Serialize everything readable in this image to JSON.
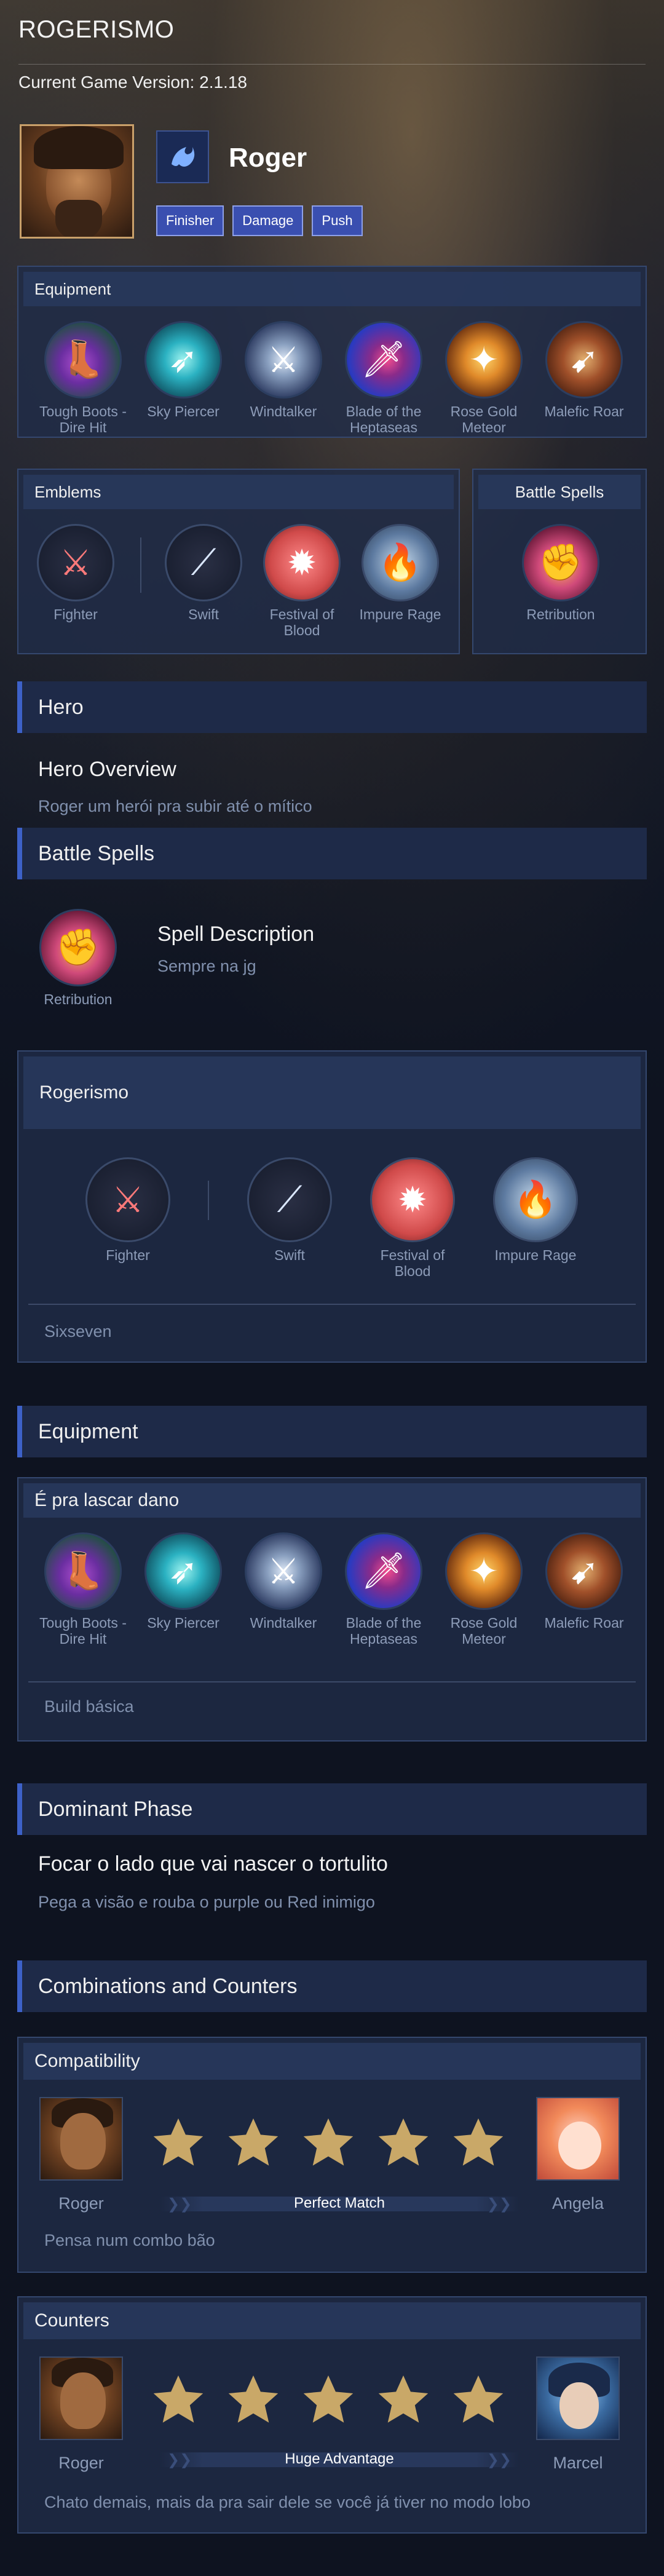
{
  "app_title": "ROGERISMO",
  "game_version": "Current Game Version: 2.1.18",
  "hero": {
    "name": "Roger",
    "tags": [
      "Finisher",
      "Damage",
      "Push"
    ]
  },
  "equipment_panel": {
    "title": "Equipment",
    "items": [
      {
        "label": "Tough Boots - Dire Hit",
        "icon": "boots-icon"
      },
      {
        "label": "Sky Piercer",
        "icon": "sky-piercer-icon"
      },
      {
        "label": "Windtalker",
        "icon": "windtalker-icon"
      },
      {
        "label": "Blade of the Heptaseas",
        "icon": "blade-icon"
      },
      {
        "label": "Rose Gold Meteor",
        "icon": "rose-gold-meteor-icon"
      },
      {
        "label": "Malefic Roar",
        "icon": "malefic-roar-icon"
      }
    ]
  },
  "emblems_panel": {
    "title": "Emblems",
    "main": "Fighter",
    "talents": [
      "Swift",
      "Festival of Blood",
      "Impure Rage"
    ]
  },
  "battle_spells_panel": {
    "title": "Battle Spells",
    "spell": "Retribution"
  },
  "hero_section": {
    "title": "Hero",
    "overview_title": "Hero Overview",
    "overview_text": "Roger um herói pra subir até o mítico"
  },
  "battle_spells_section": {
    "title": "Battle Spells",
    "spell": "Retribution",
    "desc_title": "Spell Description",
    "desc_text": "Sempre na jg"
  },
  "rogerismo_panel": {
    "title": "Rogerismo",
    "main": "Fighter",
    "talents": [
      "Swift",
      "Festival of Blood",
      "Impure Rage"
    ],
    "note": "Sixseven"
  },
  "equipment_section": {
    "title": "Equipment",
    "build_title": "É pra lascar dano",
    "items": [
      {
        "label": "Tough Boots - Dire Hit",
        "icon": "boots-icon"
      },
      {
        "label": "Sky Piercer",
        "icon": "sky-piercer-icon"
      },
      {
        "label": "Windtalker",
        "icon": "windtalker-icon"
      },
      {
        "label": "Blade of the Heptaseas",
        "icon": "blade-icon"
      },
      {
        "label": "Rose Gold Meteor",
        "icon": "rose-gold-meteor-icon"
      },
      {
        "label": "Malefic Roar",
        "icon": "malefic-roar-icon"
      }
    ],
    "note": "Build básica"
  },
  "dominant_phase": {
    "title": "Dominant Phase",
    "heading": "Focar o lado que vai nascer o tortulito",
    "text": "Pega a visão e rouba o purple ou Red inimigo"
  },
  "combos": {
    "title": "Combinations and Counters",
    "compatibility": {
      "title": "Compatibility",
      "left": "Roger",
      "right": "Angela",
      "rating": 5,
      "max": 5,
      "verdict": "Perfect Match",
      "note": "Pensa num combo bão"
    },
    "counters": {
      "title": "Counters",
      "left": "Roger",
      "right": "Marcel",
      "rating": 5,
      "max": 5,
      "verdict": "Huge Advantage",
      "note": "Chato demais, mais da pra sair dele se você já tiver no modo lobo"
    }
  },
  "colors": {
    "accent": "#3d61c8",
    "tag_bg": "#3a4fb0",
    "star": "#c9a868",
    "page_bg": "#0e1320"
  }
}
